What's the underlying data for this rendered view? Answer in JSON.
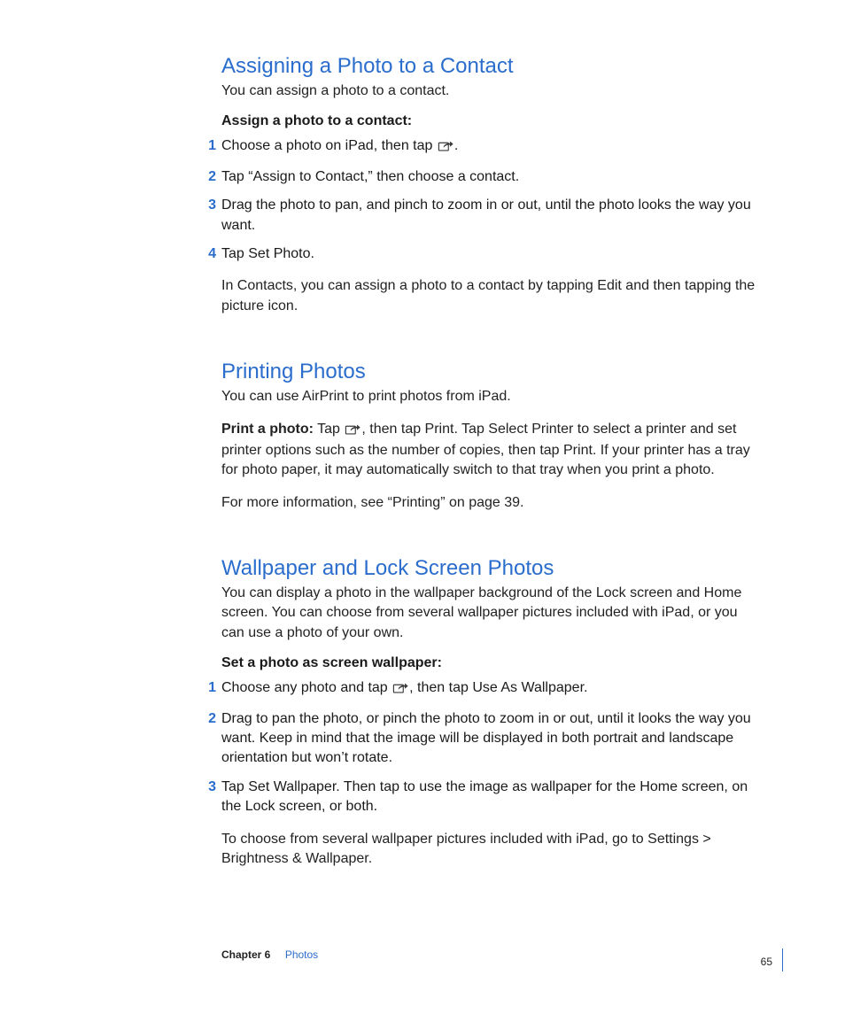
{
  "section1": {
    "heading": "Assigning a Photo to a Contact",
    "intro": "You can assign a photo to a contact.",
    "subhead": "Assign a photo to a contact:",
    "steps": [
      {
        "pre": "Choose a photo on iPad, then tap ",
        "post": "."
      },
      {
        "text": "Tap “Assign to Contact,” then choose a contact."
      },
      {
        "text": "Drag the photo to pan, and pinch to zoom in or out, until the photo looks the way you want."
      },
      {
        "text": "Tap Set Photo."
      }
    ],
    "after": "In Contacts, you can assign a photo to a contact by tapping Edit and then tapping the picture icon."
  },
  "section2": {
    "heading": "Printing Photos",
    "intro": "You can use AirPrint to print photos from iPad.",
    "print_lead": "Print a photo:",
    "print_pre": "  Tap ",
    "print_post": ", then tap Print. Tap Select Printer to select a printer and set printer options such as the number of copies, then tap Print. If your printer has a tray for photo paper, it may automatically switch to that tray when you print a photo.",
    "more": "For more information, see “Printing” on page 39."
  },
  "section3": {
    "heading": "Wallpaper and Lock Screen Photos",
    "intro": "You can display a photo in the wallpaper background of the Lock screen and Home screen. You can choose from several wallpaper pictures included with iPad, or you can use a photo of your own.",
    "subhead": "Set a photo as screen wallpaper:",
    "steps": [
      {
        "pre": "Choose any photo and tap ",
        "post": ", then tap Use As Wallpaper."
      },
      {
        "text": "Drag to pan the photo, or pinch the photo to zoom in or out, until it looks the way you want. Keep in mind that the image will be displayed in both portrait and landscape orientation but won’t rotate."
      },
      {
        "text": "Tap Set Wallpaper. Then tap to use the image as wallpaper for the Home screen, on the Lock screen, or both."
      }
    ],
    "after": "To choose from several wallpaper pictures included with iPad, go to Settings > Brightness & Wallpaper."
  },
  "footer": {
    "chapter": "Chapter 6",
    "section": "Photos",
    "page": "65"
  }
}
